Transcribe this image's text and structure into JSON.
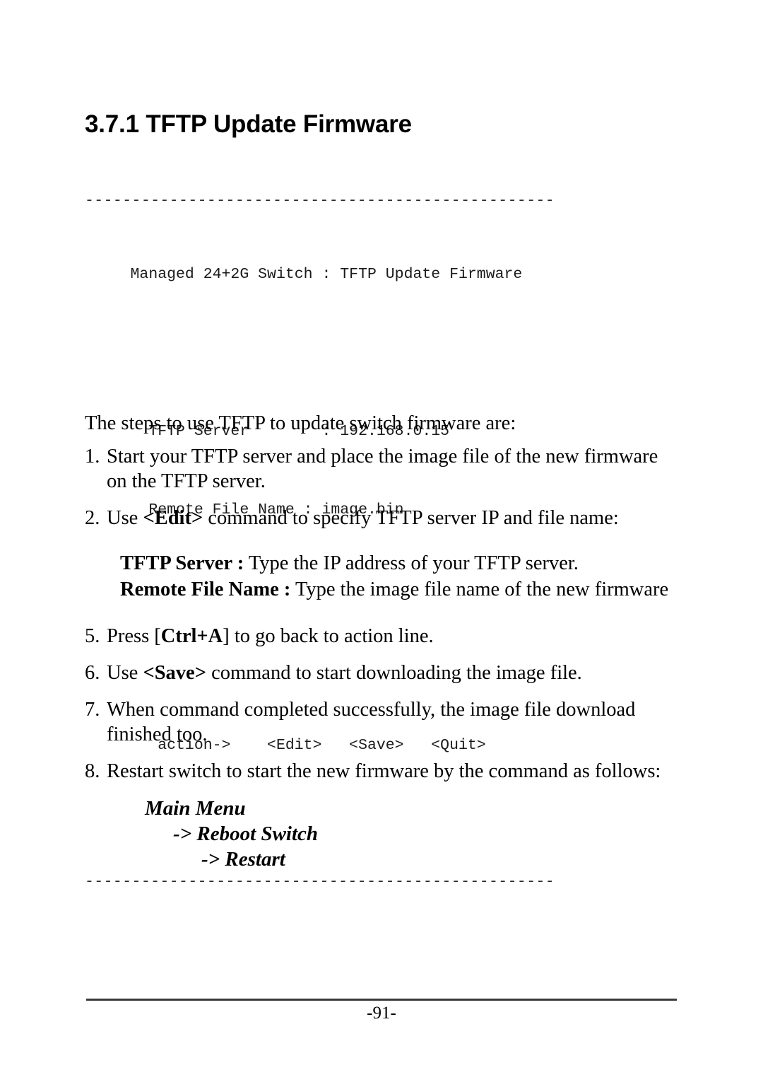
{
  "page": {
    "heading": "3.7.1 TFTP Update Firmware",
    "footer_page_number": "-91-"
  },
  "console": {
    "top_rule": "--------------------------------------------------",
    "bottom_rule": "--------------------------------------------------",
    "title_line": "     Managed 24+2G Switch : TFTP Update Firmware",
    "field_server": "       TFTP Server        : 192.168.0.15",
    "field_remote_file": "       Remote File Name : image.bin",
    "action_line": "        action->    <Edit>   <Save>   <Quit>",
    "fields": [
      {
        "label": "TFTP Server",
        "value": "192.168.0.15"
      },
      {
        "label": "Remote File Name",
        "value": "image.bin"
      }
    ],
    "actions": [
      "<Edit>",
      "<Save>",
      "<Quit>"
    ],
    "action_prompt": "action->"
  },
  "body": {
    "intro": "The steps to use TFTP to update switch firmware are:",
    "steps": [
      {
        "num": "1.",
        "parts": [
          {
            "t": "Start your TFTP server and place the image file of the new firmware on the TFTP server.",
            "b": false
          }
        ]
      },
      {
        "num": "2.",
        "parts": [
          {
            "t": "Use ",
            "b": false
          },
          {
            "t": "<Edit>",
            "b": true
          },
          {
            "t": " command to specify TFTP server IP and file name:",
            "b": false
          }
        ]
      },
      {
        "num": "5.",
        "parts": [
          {
            "t": "Press [",
            "b": false
          },
          {
            "t": "Ctrl+A",
            "b": true
          },
          {
            "t": "] to go back to action line.",
            "b": false
          }
        ]
      },
      {
        "num": "6.",
        "parts": [
          {
            "t": "Use ",
            "b": false
          },
          {
            "t": "<Save>",
            "b": true
          },
          {
            "t": " command to start downloading the image file.",
            "b": false
          }
        ]
      },
      {
        "num": "7.",
        "parts": [
          {
            "t": "When  command completed successfully, the image file download finished too.",
            "b": false
          }
        ]
      },
      {
        "num": "8.",
        "parts": [
          {
            "t": "Restart switch to start the new firmware by the command as follows:",
            "b": false
          }
        ]
      }
    ],
    "definitions": [
      {
        "term": "TFTP Server :",
        "desc": " Type the IP address of your TFTP server."
      },
      {
        "term": "Remote File Name :",
        "desc": " Type the image file name of the new firmware"
      }
    ],
    "menu_path": [
      "Main Menu",
      "-> Reboot Switch",
      "-> Restart"
    ]
  }
}
